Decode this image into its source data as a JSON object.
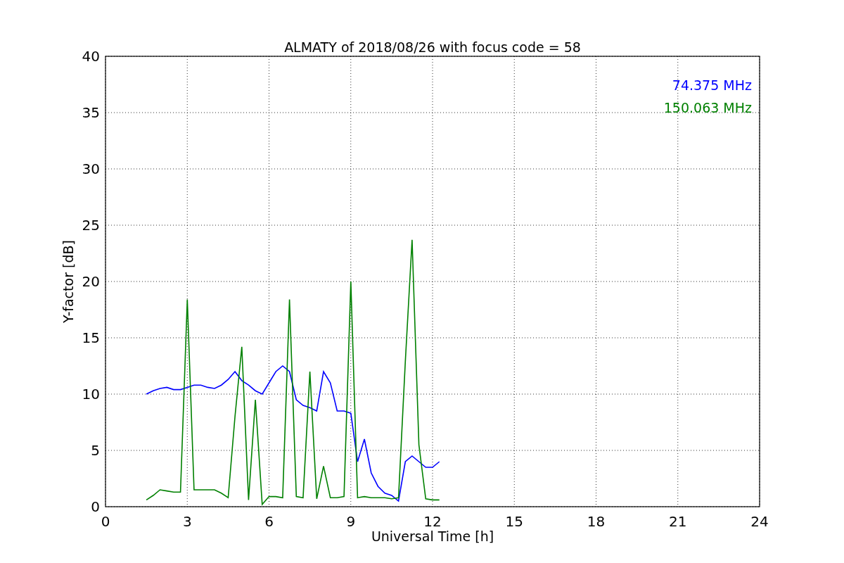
{
  "chart_data": {
    "type": "line",
    "title": "ALMATY of 2018/08/26 with focus code = 58",
    "xlabel": "Universal Time [h]",
    "ylabel": "Y-factor [dB]",
    "x": [
      1.5,
      1.75,
      2,
      2.25,
      2.5,
      2.75,
      3,
      3.25,
      3.5,
      3.75,
      4,
      4.25,
      4.5,
      4.75,
      5,
      5.25,
      5.5,
      5.75,
      6,
      6.25,
      6.5,
      6.75,
      7,
      7.25,
      7.5,
      7.75,
      8,
      8.25,
      8.5,
      8.75,
      9,
      9.25,
      9.5,
      9.75,
      10,
      10.25,
      10.5,
      10.75,
      11,
      11.25,
      11.5,
      11.75,
      12,
      12.25
    ],
    "series": [
      {
        "name": "74.375 MHz",
        "color": "#0000ff",
        "values": [
          10,
          10.3,
          10.5,
          10.6,
          10.4,
          10.4,
          10.6,
          10.8,
          10.8,
          10.6,
          10.5,
          10.8,
          11.3,
          12,
          11.2,
          10.8,
          10.3,
          10,
          11,
          12,
          12.5,
          12,
          9.5,
          9,
          8.8,
          8.5,
          12,
          11,
          8.5,
          8.5,
          8.3,
          4,
          6,
          3,
          1.8,
          1.2,
          1,
          0.5,
          4,
          4.5,
          4,
          3.5,
          3.5,
          4
        ]
      },
      {
        "name": "150.063 MHz",
        "color": "#008000",
        "values": [
          0.6,
          1,
          1.5,
          1.4,
          1.3,
          1.3,
          18.4,
          1.5,
          1.5,
          1.5,
          1.5,
          1.2,
          0.8,
          8,
          14.2,
          0.6,
          9.5,
          0.2,
          0.9,
          0.9,
          0.8,
          18.4,
          0.9,
          0.8,
          12,
          0.7,
          3.6,
          0.8,
          0.8,
          0.9,
          20,
          0.8,
          0.9,
          0.8,
          0.8,
          0.8,
          0.7,
          0.8,
          12.9,
          23.7,
          5.5,
          0.7,
          0.6,
          0.6
        ]
      }
    ],
    "grid": true,
    "xlim": [
      0,
      24
    ],
    "ylim": [
      0,
      40
    ],
    "xticks": [
      0,
      3,
      6,
      9,
      12,
      15,
      18,
      21,
      24
    ],
    "yticks": [
      0,
      5,
      10,
      15,
      20,
      25,
      30,
      35,
      40
    ]
  }
}
